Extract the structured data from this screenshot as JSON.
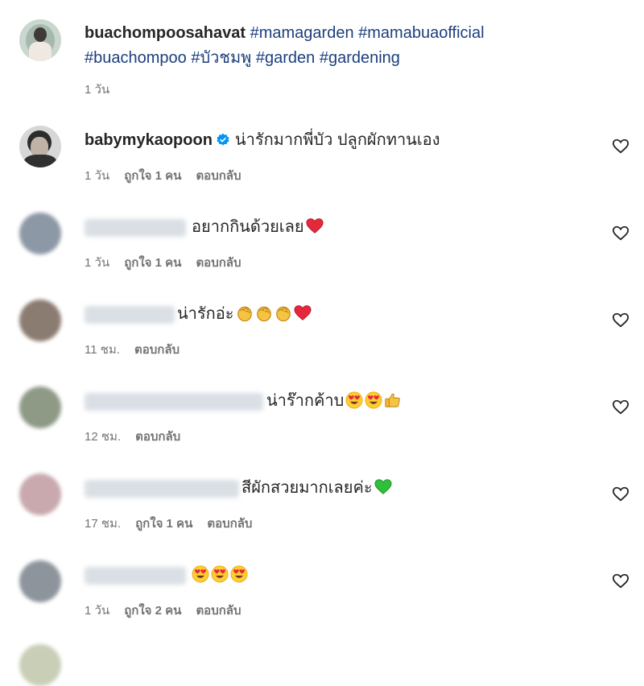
{
  "caption": {
    "username": "buachompoosahavat",
    "line1_tags": "#mamagarden #mamabuaofficial",
    "line2_tags": "#buachompoo #บัวชมพู #garden #gardening",
    "time": "1 วัน"
  },
  "comments": [
    {
      "username": "babymykaopoon",
      "text": "น่ารักมากพี่บัว ปลูกผักทานเอง",
      "time": "1 วัน",
      "likes": "ถูกใจ 1 คน",
      "reply": "ตอบกลับ",
      "emojis": []
    },
    {
      "text": "อยากกินด้วยเลย",
      "time": "1 วัน",
      "likes": "ถูกใจ 1 คน",
      "reply": "ตอบกลับ",
      "emojis": [
        "red-heart"
      ]
    },
    {
      "text": "น่ารักอ่ะ",
      "time": "11 ชม.",
      "reply": "ตอบกลับ",
      "emojis": [
        "clap",
        "clap",
        "clap",
        "red-heart"
      ]
    },
    {
      "text": "น่าร๊ากค้าบ",
      "time": "12 ชม.",
      "reply": "ตอบกลับ",
      "emojis": [
        "heart-eyes",
        "heart-eyes",
        "thumbs-up"
      ]
    },
    {
      "text": "สีผักสวยมากเลยค่ะ",
      "time": "17 ชม.",
      "likes": "ถูกใจ 1 คน",
      "reply": "ตอบกลับ",
      "emojis": [
        "green-heart"
      ]
    },
    {
      "text": "",
      "time": "1 วัน",
      "likes": "ถูกใจ 2 คน",
      "reply": "ตอบกลับ",
      "emojis": [
        "heart-eyes",
        "heart-eyes",
        "heart-eyes"
      ]
    }
  ],
  "colors": {
    "hashtag": "#1c3f7d",
    "meta": "#737373",
    "verified": "#0095f6",
    "text": "#262626"
  }
}
